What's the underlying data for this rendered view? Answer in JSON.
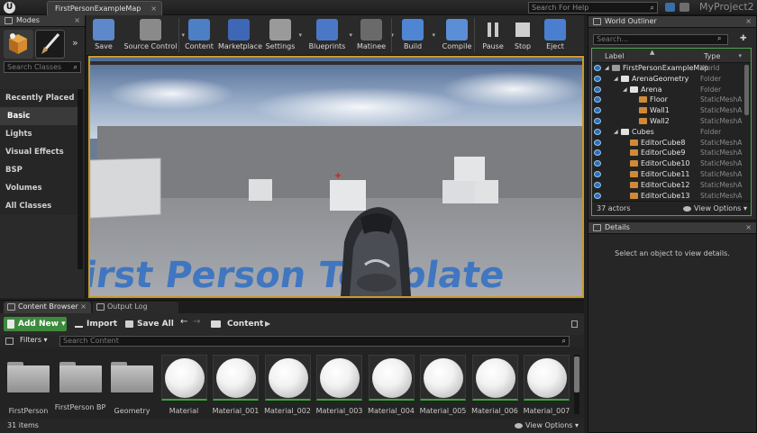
{
  "titlebar": {
    "logo_text": "U",
    "document_tab": "FirstPersonExampleMap",
    "document_tab_close": "×",
    "help_search_placeholder": "Search For Help",
    "project_name": "MyProject2"
  },
  "modes": {
    "tab_label": "Modes",
    "search_placeholder": "Search Classes",
    "categories": [
      "Recently Placed",
      "Basic",
      "Lights",
      "Visual Effects",
      "BSP",
      "Volumes",
      "All Classes"
    ],
    "active_category": "Basic"
  },
  "toolbar": {
    "buttons": [
      {
        "label": "Save",
        "icon": "floppy-disk-icon"
      },
      {
        "label": "Source Control",
        "icon": "source-control-icon"
      },
      {
        "label": "Content",
        "icon": "content-grid-icon"
      },
      {
        "label": "Marketplace",
        "icon": "marketplace-bag-icon"
      },
      {
        "label": "Settings",
        "icon": "gears-icon"
      },
      {
        "label": "Blueprints",
        "icon": "blueprint-icon"
      },
      {
        "label": "Matinee",
        "icon": "clapperboard-icon"
      },
      {
        "label": "Build",
        "icon": "build-blocks-icon"
      },
      {
        "label": "Compile",
        "icon": "compile-cubes-icon"
      },
      {
        "label": "Pause",
        "icon": "pause-icon"
      },
      {
        "label": "Stop",
        "icon": "stop-icon"
      },
      {
        "label": "Eject",
        "icon": "eject-person-icon"
      }
    ]
  },
  "viewport": {
    "floor_text": "First Person Template"
  },
  "outliner": {
    "tab_label": "World Outliner",
    "search_placeholder": "Search...",
    "col_label": "Label",
    "col_type": "Type",
    "rows": [
      {
        "label": "FirstPersonExampleMap",
        "type": "World",
        "indent": 0,
        "kind": "world"
      },
      {
        "label": "ArenaGeometry",
        "type": "Folder",
        "indent": 1,
        "kind": "folder"
      },
      {
        "label": "Arena",
        "type": "Folder",
        "indent": 2,
        "kind": "folder"
      },
      {
        "label": "Floor",
        "type": "StaticMeshA",
        "indent": 3,
        "kind": "mesh"
      },
      {
        "label": "Wall1",
        "type": "StaticMeshA",
        "indent": 3,
        "kind": "mesh"
      },
      {
        "label": "Wall2",
        "type": "StaticMeshA",
        "indent": 3,
        "kind": "mesh"
      },
      {
        "label": "Cubes",
        "type": "Folder",
        "indent": 1,
        "kind": "folder"
      },
      {
        "label": "EditorCube8",
        "type": "StaticMeshA",
        "indent": 2,
        "kind": "mesh"
      },
      {
        "label": "EditorCube9",
        "type": "StaticMeshA",
        "indent": 2,
        "kind": "mesh"
      },
      {
        "label": "EditorCube10",
        "type": "StaticMeshA",
        "indent": 2,
        "kind": "mesh"
      },
      {
        "label": "EditorCube11",
        "type": "StaticMeshA",
        "indent": 2,
        "kind": "mesh"
      },
      {
        "label": "EditorCube12",
        "type": "StaticMeshA",
        "indent": 2,
        "kind": "mesh"
      },
      {
        "label": "EditorCube13",
        "type": "StaticMeshA",
        "indent": 2,
        "kind": "mesh"
      }
    ],
    "actor_count": "37 actors",
    "view_options": "View Options"
  },
  "details": {
    "tab_label": "Details",
    "empty_message": "Select an object to view details."
  },
  "content_browser": {
    "tab_label": "Content Browser",
    "output_tab_label": "Output Log",
    "add_new": "Add New",
    "import": "Import",
    "save_all": "Save All",
    "path": "Content",
    "filters": "Filters",
    "search_placeholder": "Search Content",
    "assets": [
      {
        "name": "FirstPerson",
        "kind": "folder"
      },
      {
        "name": "FirstPerson BP",
        "kind": "folder"
      },
      {
        "name": "Geometry",
        "kind": "folder"
      },
      {
        "name": "Material",
        "kind": "material"
      },
      {
        "name": "Material_001",
        "kind": "material"
      },
      {
        "name": "Material_002",
        "kind": "material"
      },
      {
        "name": "Material_003",
        "kind": "material"
      },
      {
        "name": "Material_004",
        "kind": "material"
      },
      {
        "name": "Material_005",
        "kind": "material"
      },
      {
        "name": "Material_006",
        "kind": "material"
      },
      {
        "name": "Material_007",
        "kind": "material"
      }
    ],
    "item_count": "31 items",
    "view_options": "View Options"
  },
  "colors": {
    "accent_green": "#3d8a3d",
    "viewport_border": "#c79a2c",
    "outliner_border": "#4da64d"
  }
}
